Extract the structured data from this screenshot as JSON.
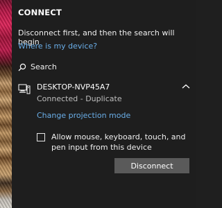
{
  "panel": {
    "title": "CONNECT",
    "info_text": "Disconnect first, and then the search will begin",
    "where_link": "Where is my device?",
    "search_label": "Search"
  },
  "device": {
    "name": "DESKTOP-NVP45A7",
    "status": "Connected - Duplicate",
    "projection_link": "Change projection mode",
    "allow_input_label": "Allow mouse, keyboard, touch, and pen input from this device",
    "allow_input_checked": false,
    "disconnect_label": "Disconnect"
  },
  "icons": {
    "search": "search-icon",
    "device": "computer-icon",
    "collapse": "chevron-up-icon"
  },
  "colors": {
    "panel_bg": "#1e1e1e",
    "link": "#6aaee8",
    "button_bg": "#5a5a5a"
  }
}
